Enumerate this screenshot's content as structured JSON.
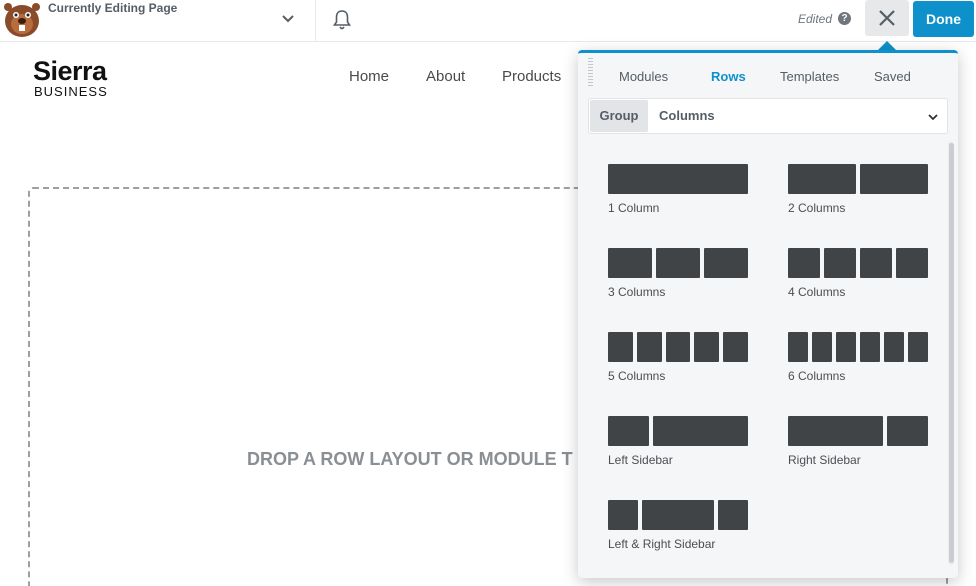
{
  "topbar": {
    "editing_label": "Currently Editing Page",
    "edited_status": "Edited",
    "help_glyph": "?",
    "done_label": "Done"
  },
  "site": {
    "name": "Sierra",
    "tagline": "BUSINESS",
    "nav": [
      "Home",
      "About",
      "Products"
    ]
  },
  "canvas": {
    "drop_text": "DROP A ROW LAYOUT OR MODULE T"
  },
  "panel": {
    "tabs": [
      "Modules",
      "Rows",
      "Templates",
      "Saved"
    ],
    "active_tab": "Rows",
    "group_label": "Group",
    "group_value": "Columns",
    "layouts": [
      {
        "label": "1 Column"
      },
      {
        "label": "2 Columns"
      },
      {
        "label": "3 Columns"
      },
      {
        "label": "4 Columns"
      },
      {
        "label": "5 Columns"
      },
      {
        "label": "6 Columns"
      },
      {
        "label": "Left Sidebar"
      },
      {
        "label": "Right Sidebar"
      },
      {
        "label": "Left & Right Sidebar"
      }
    ]
  },
  "colors": {
    "accent": "#0e91ca",
    "column_block": "#404447",
    "panel_bg": "#f5f6f7"
  },
  "icons": [
    "beaver-logo-icon",
    "chevron-down-icon",
    "bell-icon",
    "help-icon",
    "close-icon",
    "drag-handle-icon"
  ]
}
